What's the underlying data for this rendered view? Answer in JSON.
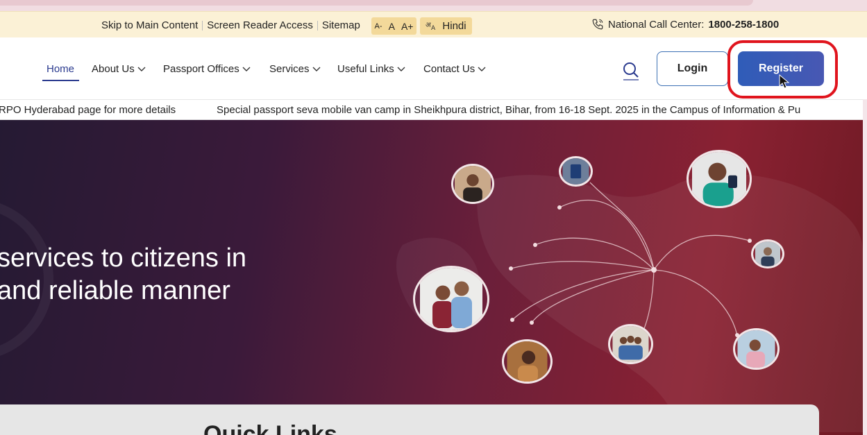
{
  "utility": {
    "skip_link": "Skip to Main Content",
    "screen_reader": "Screen Reader Access",
    "sitemap": "Sitemap",
    "font_small": "A-",
    "font_normal": "A",
    "font_large": "A+",
    "hindi_label": "Hindi",
    "call_label": "National Call Center:",
    "call_number": "1800-258-1800"
  },
  "nav": {
    "items": [
      {
        "label": "Home",
        "active": true
      },
      {
        "label": "About Us"
      },
      {
        "label": "Passport Offices"
      },
      {
        "label": "Services"
      },
      {
        "label": "Useful Links"
      },
      {
        "label": "Contact Us"
      }
    ],
    "login_label": "Login",
    "register_label": "Register"
  },
  "ticker": {
    "item_1": "RPO Hyderabad page for more details",
    "item_2": "Special passport seva mobile van camp in Sheikhpura district, Bihar, from 16-18 Sept. 2025 in the Campus of Information & Pu"
  },
  "hero": {
    "line_1": "services to citizens in",
    "line_2": "and reliable manner"
  },
  "quick_links": {
    "title": "Quick Links"
  },
  "colors": {
    "accent": "#2b3b8f",
    "register": "#3a5bb6",
    "highlight": "#e0141d",
    "utility_bg": "#fbf1d6"
  }
}
